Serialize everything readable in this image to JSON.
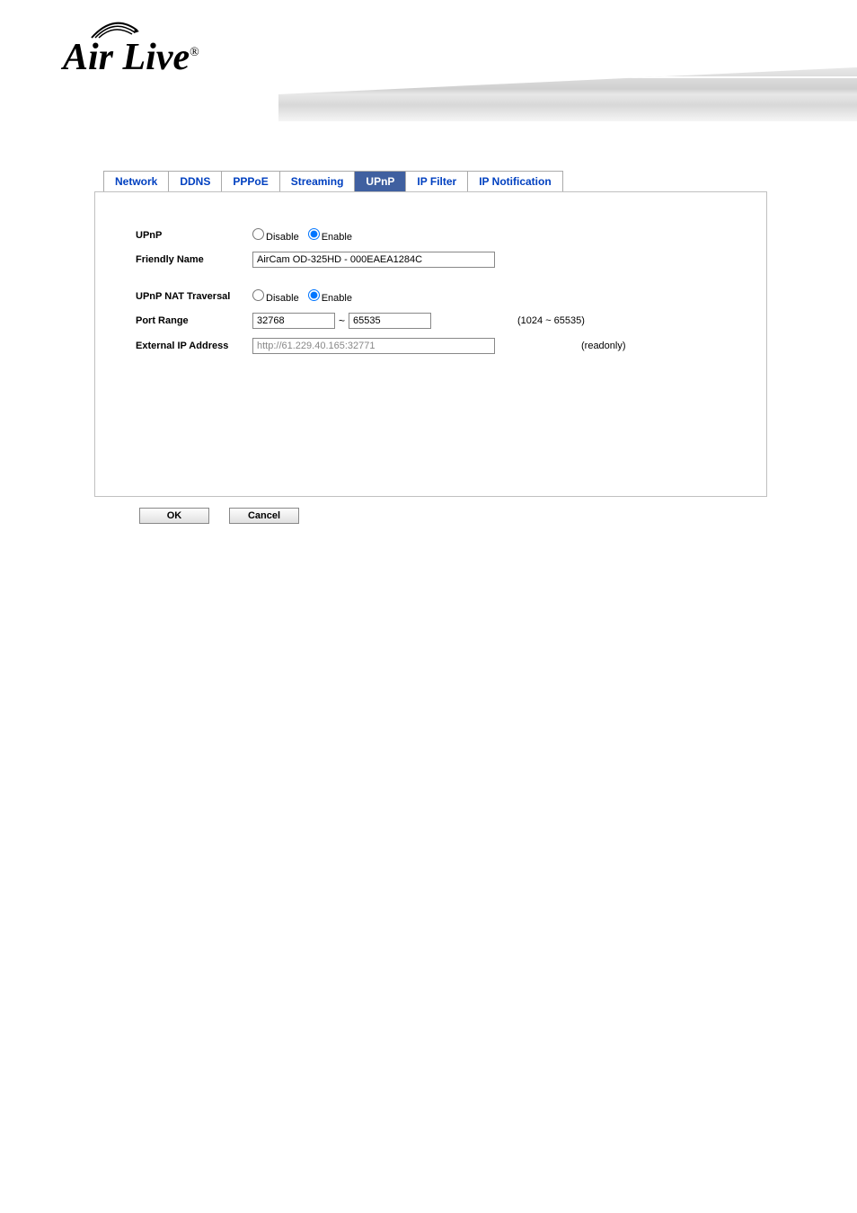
{
  "logo": {
    "text": "Air Live",
    "reg": "®"
  },
  "tabs": [
    {
      "label": "Network",
      "active": false
    },
    {
      "label": "DDNS",
      "active": false
    },
    {
      "label": "PPPoE",
      "active": false
    },
    {
      "label": "Streaming",
      "active": false
    },
    {
      "label": "UPnP",
      "active": true
    },
    {
      "label": "IP Filter",
      "active": false
    },
    {
      "label": "IP Notification",
      "active": false
    }
  ],
  "form": {
    "upnp": {
      "label": "UPnP",
      "options": {
        "disable": "Disable",
        "enable": "Enable"
      },
      "selected": "enable"
    },
    "friendlyName": {
      "label": "Friendly Name",
      "value": "AirCam OD-325HD - 000EAEA1284C"
    },
    "upnpNat": {
      "label": "UPnP NAT Traversal",
      "options": {
        "disable": "Disable",
        "enable": "Enable"
      },
      "selected": "enable"
    },
    "portRange": {
      "label": "Port Range",
      "from": "32768",
      "tilde": "~",
      "to": "65535",
      "hint": "(1024 ~ 65535)"
    },
    "externalIp": {
      "label": "External IP Address",
      "value": "http://61.229.40.165:32771",
      "hint": "(readonly)"
    }
  },
  "buttons": {
    "ok": "OK",
    "cancel": "Cancel"
  }
}
